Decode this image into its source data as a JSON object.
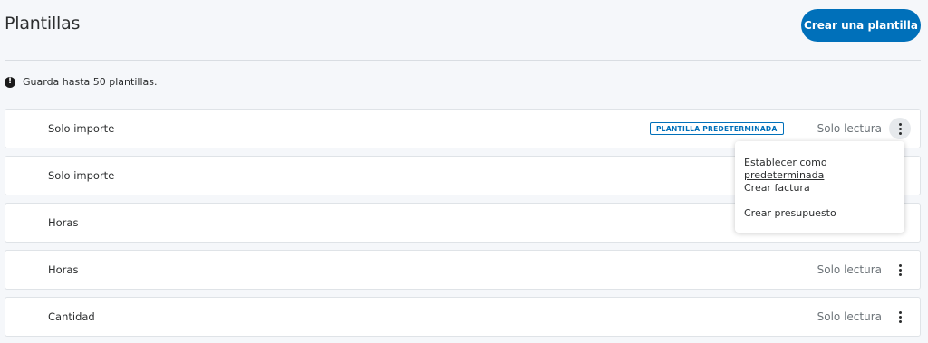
{
  "header": {
    "title": "Plantillas",
    "create_button": "Crear una plantilla"
  },
  "notice": {
    "icon": "alert-circle-icon",
    "text": "Guarda hasta 50 plantillas."
  },
  "templates": [
    {
      "name": "Solo importe",
      "badge": "PLANTILLA PREDETERMINADA",
      "status": "Solo lectura",
      "menu_open": true
    },
    {
      "name": "Solo importe",
      "badge": "",
      "status": "",
      "menu_open": false
    },
    {
      "name": "Horas",
      "badge": "",
      "status": "",
      "menu_open": false
    },
    {
      "name": "Horas",
      "badge": "",
      "status": "Solo lectura",
      "menu_open": false
    },
    {
      "name": "Cantidad",
      "badge": "",
      "status": "Solo lectura",
      "menu_open": false
    }
  ],
  "context_menu": {
    "items": [
      "Establecer como predeterminada",
      "Crear factura",
      "Crear presupuesto"
    ]
  },
  "colors": {
    "primary": "#0070ba",
    "background": "#f5f7fa",
    "text": "#2c2e2f",
    "muted": "#6c7378"
  }
}
